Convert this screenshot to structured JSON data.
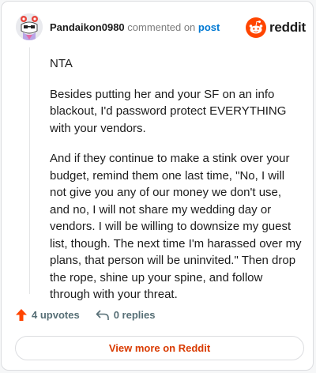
{
  "header": {
    "username": "Pandaikon0980",
    "commented_text": "commented on",
    "post_link": "post",
    "brand_word": "reddit",
    "brand_color": "#ff4500"
  },
  "comment": {
    "paragraphs": [
      "NTA",
      "Besides putting her and your SF on an info blackout, I'd password protect EVERYTHING with your vendors.",
      "And if they continue to make a stink over your budget, remind them one last time, \"No, I will not give you any of our money we don't use, and no, I will not share my wedding day or vendors. I will be willing to downsize my guest list, though. The next time I'm harassed over my plans, that person will be uninvited.\" Then drop the rope, shine up your spine, and follow through with your threat."
    ]
  },
  "actions": {
    "upvotes": "4 upvotes",
    "replies": "0 replies",
    "upvote_icon": "upvote-arrow-icon",
    "reply_icon": "reply-arrow-icon"
  },
  "footer": {
    "view_more": "View more on Reddit"
  },
  "colors": {
    "accent": "#d93a00",
    "upvote": "#ff4500",
    "link": "#0079d3"
  }
}
